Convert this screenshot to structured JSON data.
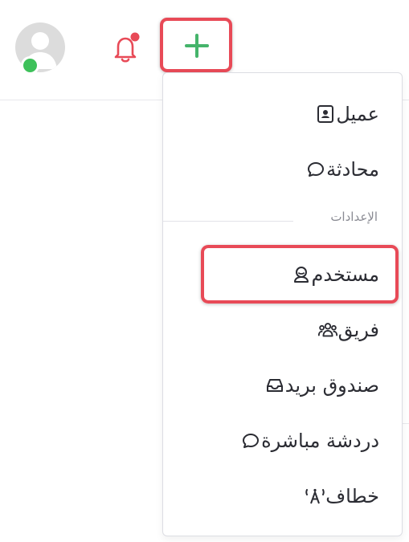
{
  "header": {
    "avatar_status_color": "#3ec15a",
    "bell_icon": "bell-icon",
    "add_icon": "plus-icon",
    "accent_color": "#45b46b",
    "alert_color": "#e84a57"
  },
  "menu": {
    "items_top": [
      {
        "label": "عميل",
        "icon": "contact-card-icon"
      },
      {
        "label": "محادثة",
        "icon": "chat-bubble-icon"
      }
    ],
    "section_title": "الإعدادات",
    "items_settings": [
      {
        "label": "مستخدم",
        "icon": "user-icon"
      },
      {
        "label": "فريق",
        "icon": "team-icon"
      },
      {
        "label": "صندوق بريد",
        "icon": "inbox-icon"
      },
      {
        "label": "دردشة مباشرة",
        "icon": "chat-bubble-icon"
      },
      {
        "label": "خطاف",
        "icon": "webhook-icon"
      }
    ]
  }
}
